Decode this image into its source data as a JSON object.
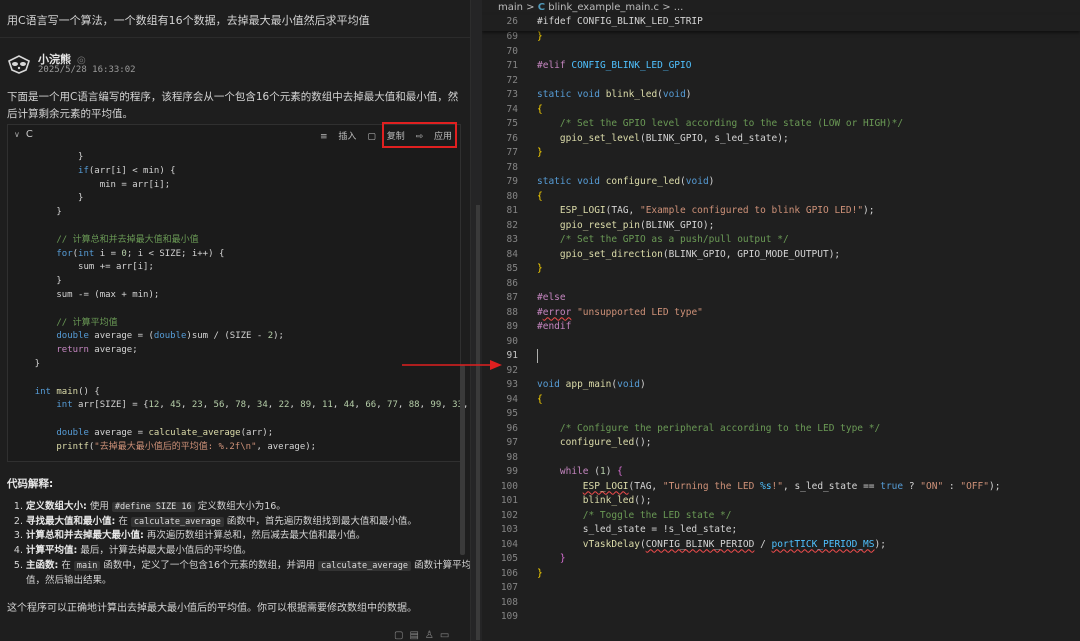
{
  "question": "用C语言写一个算法，一个数组有16个数据，去掉最大最小值然后求平均值",
  "bot": {
    "name": "小浣熊",
    "time": "2025/5/28 16:33:02"
  },
  "intro": "下面是一个用C语言编写的程序，该程序会从一个包含16个元素的数组中去掉最大值和最小值，然后计算剩余元素的平均值。",
  "codeblock": {
    "lang": "C",
    "insert_label": "插入",
    "copy_label": "复制",
    "apply_label": "应用"
  },
  "explain": {
    "title": "代码解释:",
    "items": [
      {
        "bold": "定义数组大小:",
        "pre": "使用",
        "code": "#define SIZE 16",
        "post": "定义数组大小为16。"
      },
      {
        "bold": "寻找最大值和最小值:",
        "pre": "在",
        "code": "calculate_average",
        "post": "函数中，首先遍历数组找到最大值和最小值。"
      },
      {
        "bold": "计算总和并去掉最大最小值:",
        "pre": "再次遍历数组计算总和，然后减去最大值和最小值。",
        "code": "",
        "post": ""
      },
      {
        "bold": "计算平均值:",
        "pre": "最后，计算去掉最大最小值后的平均值。",
        "code": "",
        "post": ""
      },
      {
        "bold": "主函数:",
        "pre": "在",
        "code": "main",
        "post": "函数中，定义了一个包含16个元素的数组，并调用",
        "code2": "calculate_average",
        "post2": "函数计算平均值，然后输出结果。"
      }
    ]
  },
  "summary": "这个程序可以正确地计算出去掉最大最小值后的平均值。你可以根据需要修改数组中的数据。",
  "editor": {
    "branch": "main",
    "file_icon": "C",
    "file": "blink_example_main.c",
    "crumb_rest": "> ...",
    "sticky": {
      "num": "26",
      "text": "#ifdef CONFIG_BLINK_LED_STRIP"
    }
  }
}
